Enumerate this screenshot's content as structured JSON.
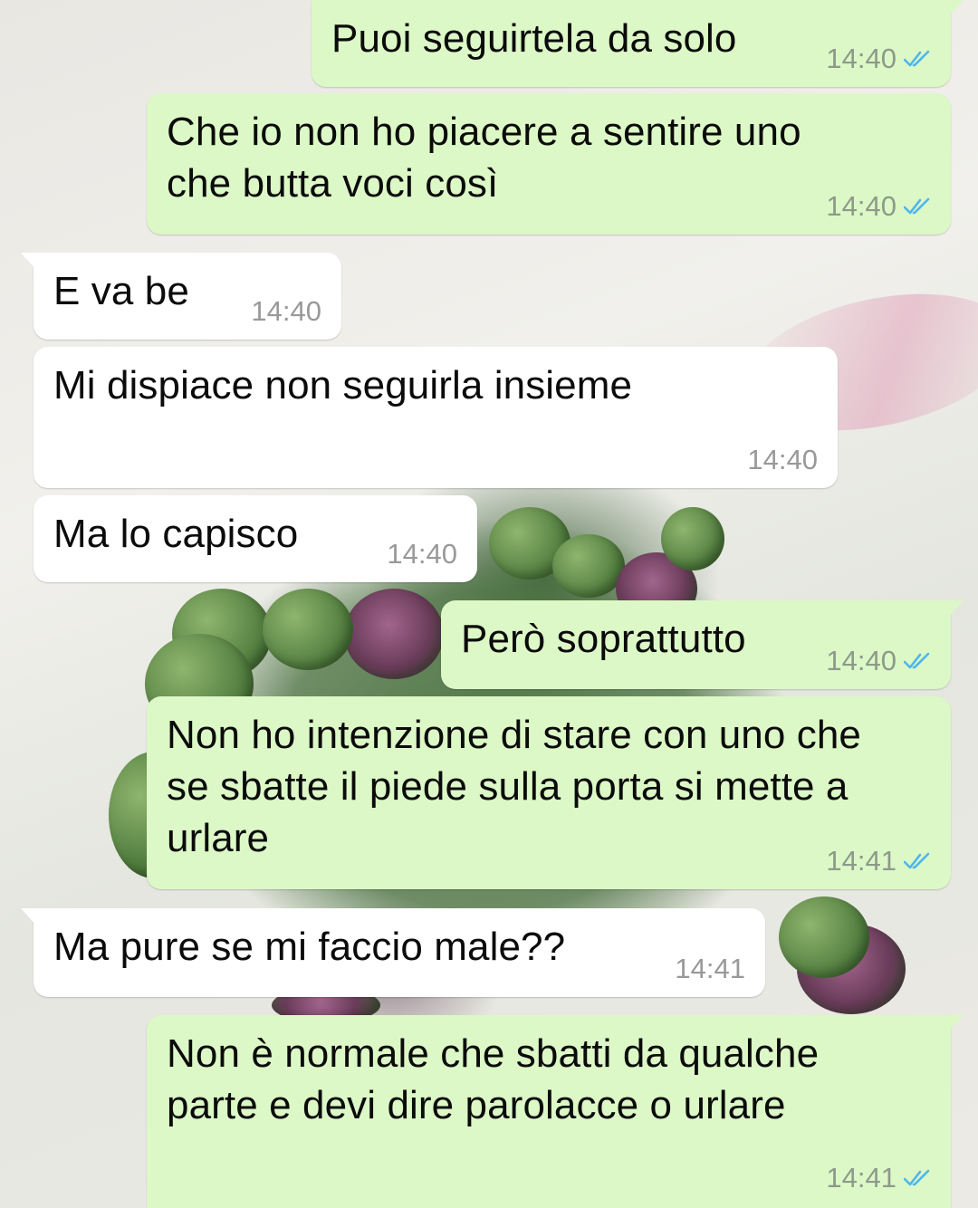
{
  "colors": {
    "outgoing_bubble": "#dcf8c6",
    "incoming_bubble": "#ffffff",
    "read_ticks": "#4fb6ec",
    "timestamp": "#8d9a8a"
  },
  "messages": [
    {
      "direction": "outgoing",
      "text": "Puoi seguirtela da solo",
      "time": "14:40",
      "status": "read",
      "status_icon": "double-check-icon"
    },
    {
      "direction": "outgoing",
      "text": "Che io non ho piacere a sentire uno\nche butta voci così",
      "time": "14:40",
      "status": "read",
      "status_icon": "double-check-icon"
    },
    {
      "direction": "incoming",
      "text": "E va be",
      "time": "14:40"
    },
    {
      "direction": "incoming",
      "text": "Mi dispiace non seguirla insieme",
      "time": "14:40"
    },
    {
      "direction": "incoming",
      "text": "Ma lo capisco",
      "time": "14:40"
    },
    {
      "direction": "outgoing",
      "text": "Però soprattutto",
      "time": "14:40",
      "status": "read",
      "status_icon": "double-check-icon"
    },
    {
      "direction": "outgoing",
      "text": "Non ho intenzione di stare con uno che\nse sbatte il piede sulla porta si mette a\nurlare",
      "time": "14:41",
      "status": "read",
      "status_icon": "double-check-icon"
    },
    {
      "direction": "incoming",
      "text": "Ma pure se mi faccio male??",
      "time": "14:41"
    },
    {
      "direction": "outgoing",
      "text": "Non è normale che sbatti da qualche\nparte e devi dire parolacce o urlare",
      "time": "14:41",
      "status": "read",
      "status_icon": "double-check-icon"
    }
  ]
}
